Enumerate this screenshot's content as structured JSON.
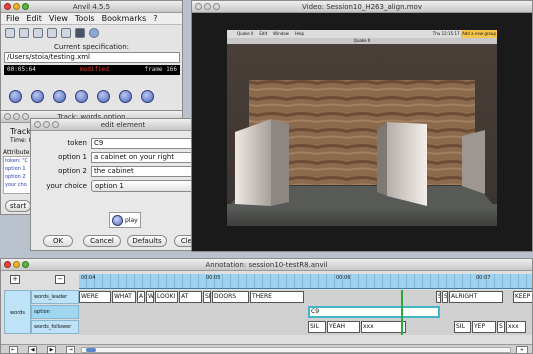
{
  "desktop": {
    "bg": "#b9c2cc"
  },
  "anvil_main": {
    "title": "Anvil 4.5.5",
    "menu": [
      "File",
      "Edit",
      "View",
      "Tools",
      "Bookmarks",
      "?"
    ],
    "spec_label": "Current specification:",
    "spec_path": "/Users/stoia/testing.xml",
    "timecode": "00:05:64",
    "modified": "modified",
    "frame": "frame 166",
    "toolbar_icons": [
      "folder-icon",
      "save-icon",
      "print-icon",
      "network-icon",
      "print-alt-icon",
      "binoculars-icon",
      "globe-icon"
    ],
    "playback_buttons": [
      "rewind-button",
      "step-back-button",
      "back-button",
      "play-button",
      "forward-button",
      "step-forward-button",
      "end-button"
    ]
  },
  "track_window": {
    "title": "Track: words.option",
    "track_label": "Track",
    "time_label": "Time: 8",
    "attributes_label": "Attributes",
    "attr_lines": [
      "token: \"C",
      "option 1",
      "option 2",
      "your cho"
    ],
    "start_label": "start"
  },
  "edit_element": {
    "title": "edit element",
    "fields": [
      {
        "label": "token",
        "value": "C9"
      },
      {
        "label": "option 1",
        "value": "a cabinet on your right"
      },
      {
        "label": "option 2",
        "value": "the cabinet"
      }
    ],
    "choice_label": "your choice",
    "choice_value": "option 1",
    "play_label": "play",
    "buttons": {
      "ok": "OK",
      "cancel": "Cancel",
      "defaults": "Defaults",
      "clear": "Clear"
    }
  },
  "video_window": {
    "title": "Video: Session10_H263_align.mov",
    "inner_menu": [
      "Quake II",
      "Edit",
      "Window",
      "Help"
    ],
    "inner_title": "Quake II",
    "inner_right": "Thu 12:15:17 AM",
    "inner_user": "stoia",
    "inner_tag": "Add a new group"
  },
  "annotation": {
    "title": "Annotation: session10-testR8.anvil",
    "group_label": "words",
    "ruler": [
      "00:04",
      "00:05",
      "00:06",
      "00:07"
    ],
    "tiers": [
      {
        "name": "words_leader",
        "cells": [
          "WERE",
          "WHAT",
          "A",
          "W",
          "LOOKI",
          "AT",
          "SI",
          "DOORS",
          "THERE",
          "S",
          "S",
          "ALRIGHT",
          "KEEP"
        ]
      },
      {
        "name": "option",
        "cells": [
          "C9"
        ]
      },
      {
        "name": "words_follower",
        "cells": [
          "SIL",
          "YEAH",
          "xxx",
          "SIL",
          "YEP",
          "S",
          "xxx"
        ]
      }
    ],
    "colors": {
      "tier_label": "#bfe3f6",
      "ruler": "#9ed2ee",
      "selection": "#3fb6c8",
      "cursor": "#2aa83a"
    }
  }
}
